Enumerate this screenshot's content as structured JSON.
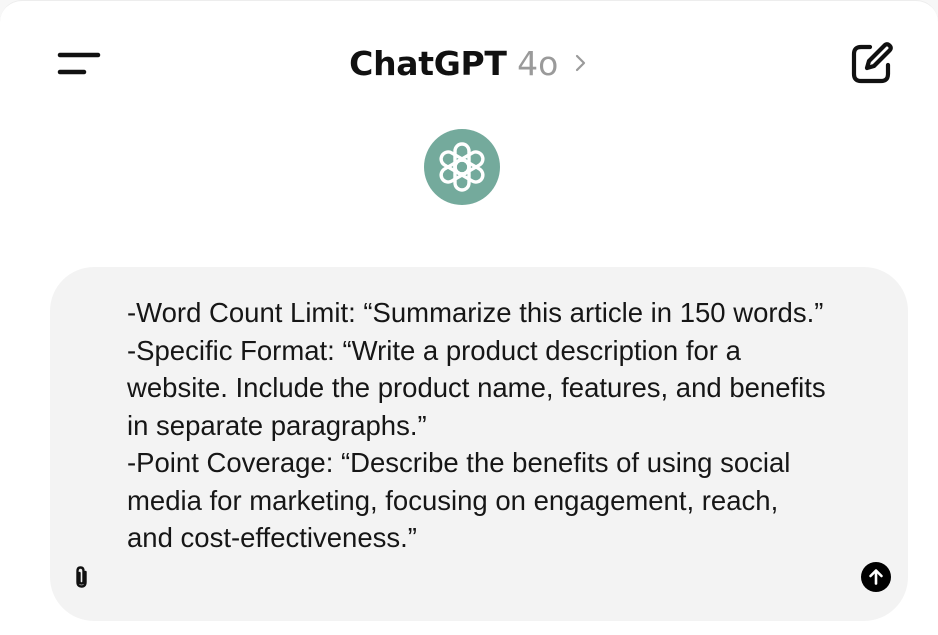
{
  "header": {
    "title": "ChatGPT",
    "model": "4o",
    "icons": {
      "menu": "menu-icon",
      "model_chevron": "chevron-right-icon",
      "new_chat": "new-chat-icon"
    }
  },
  "logo": {
    "icon": "openai-logo-icon",
    "color": "#74aa9c"
  },
  "composer": {
    "text": "-Word Count Limit: “Summarize this article in 150 words.”\n-Specific Format: “Write a product description for a website. Include the product name, features, and benefits in separate paragraphs.”\n-Point Coverage: “Describe the benefits of using social media for marketing, focusing on engagement, reach, and cost-effectiveness.”",
    "icons": {
      "attach": "paperclip-icon",
      "send": "arrow-up-icon"
    },
    "background": "#f3f3f3"
  }
}
